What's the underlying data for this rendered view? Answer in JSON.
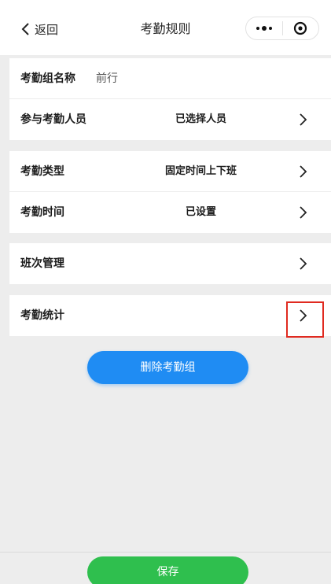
{
  "header": {
    "back_label": "返回",
    "title": "考勤规则"
  },
  "groups": [
    {
      "rows": [
        {
          "label": "考勤组名称",
          "value": "前行",
          "has_arrow": false
        },
        {
          "label": "参与考勤人员",
          "value": "已选择人员",
          "has_arrow": true
        }
      ]
    },
    {
      "rows": [
        {
          "label": "考勤类型",
          "value": "固定时间上下班",
          "has_arrow": true
        },
        {
          "label": "考勤时间",
          "value": "已设置",
          "has_arrow": true
        }
      ]
    },
    {
      "rows": [
        {
          "label": "班次管理",
          "value": "",
          "has_arrow": true
        }
      ]
    },
    {
      "rows": [
        {
          "label": "考勤统计",
          "value": "",
          "has_arrow": true
        }
      ]
    }
  ],
  "actions": {
    "delete_label": "删除考勤组",
    "save_label": "保存"
  },
  "colors": {
    "delete_button": "#1f8cf3",
    "save_button": "#2fbf4e",
    "highlight_box": "#e02a20"
  },
  "icons": {
    "back": "chevron-left-icon",
    "more": "more-dots-icon",
    "close": "target-circle-icon",
    "row_arrow": "chevron-right-icon"
  }
}
